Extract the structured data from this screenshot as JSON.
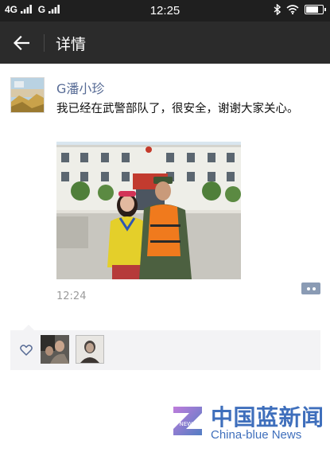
{
  "status_bar": {
    "carrier1": "4G",
    "carrier2": "G",
    "time": "12:25",
    "battery_level": 0.8
  },
  "header": {
    "title": "详情",
    "back_icon": "arrow-left-icon"
  },
  "post": {
    "author": "G潘小珍",
    "text": "我已经在武警部队了，很安全，谢谢大家关心。",
    "time": "12:24"
  },
  "likes": {
    "icon": "heart-outline-icon",
    "count_avatars": 2
  },
  "watermark": {
    "cn": "中国蓝新闻",
    "en": "China-blue News",
    "logo_text": "NEWS"
  },
  "colors": {
    "status_bar": "#1f1f1f",
    "title_bar": "#2b2b2b",
    "author_name": "#576b95",
    "like_panel": "#f3f3f5",
    "watermark": "#3f6fbc"
  }
}
